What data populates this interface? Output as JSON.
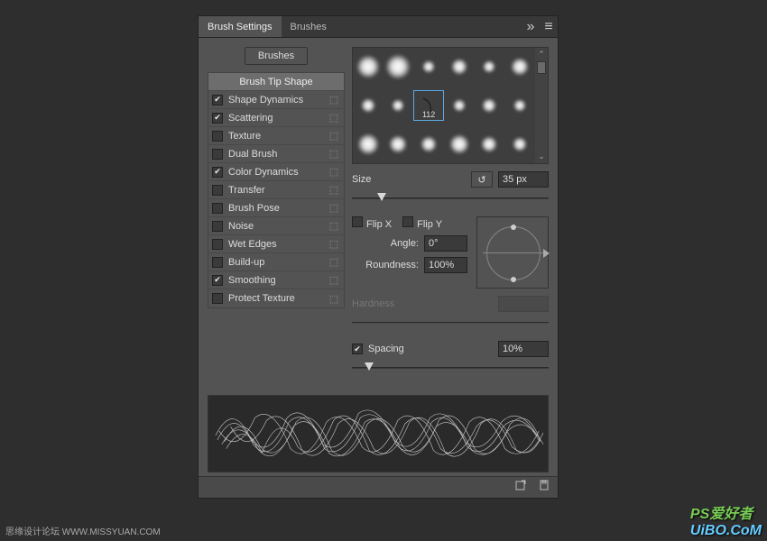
{
  "tabs": {
    "settings": "Brush Settings",
    "brushes": "Brushes"
  },
  "brushes_button": "Brushes",
  "options_header": "Brush Tip Shape",
  "options": [
    {
      "label": "Shape Dynamics",
      "checked": true,
      "lock": true
    },
    {
      "label": "Scattering",
      "checked": true,
      "lock": true
    },
    {
      "label": "Texture",
      "checked": false,
      "lock": true
    },
    {
      "label": "Dual Brush",
      "checked": false,
      "lock": true
    },
    {
      "label": "Color Dynamics",
      "checked": true,
      "lock": true
    },
    {
      "label": "Transfer",
      "checked": false,
      "lock": true
    },
    {
      "label": "Brush Pose",
      "checked": false,
      "lock": true
    },
    {
      "label": "Noise",
      "checked": false,
      "lock": true
    },
    {
      "label": "Wet Edges",
      "checked": false,
      "lock": true
    },
    {
      "label": "Build-up",
      "checked": false,
      "lock": true
    },
    {
      "label": "Smoothing",
      "checked": true,
      "lock": true
    },
    {
      "label": "Protect Texture",
      "checked": false,
      "lock": true
    }
  ],
  "selected_brush": "112",
  "size": {
    "label": "Size",
    "value": "35 px"
  },
  "flip": {
    "x": "Flip X",
    "y": "Flip Y"
  },
  "angle": {
    "label": "Angle:",
    "value": "0°"
  },
  "roundness": {
    "label": "Roundness:",
    "value": "100%"
  },
  "hardness": {
    "label": "Hardness"
  },
  "spacing": {
    "label": "Spacing",
    "value": "10%",
    "checked": true
  },
  "watermark": {
    "left": "思缘设计论坛  WWW.MISSYUAN.COM",
    "right_a": "PS爱好者",
    "right_b": "UiBO.CoM"
  }
}
